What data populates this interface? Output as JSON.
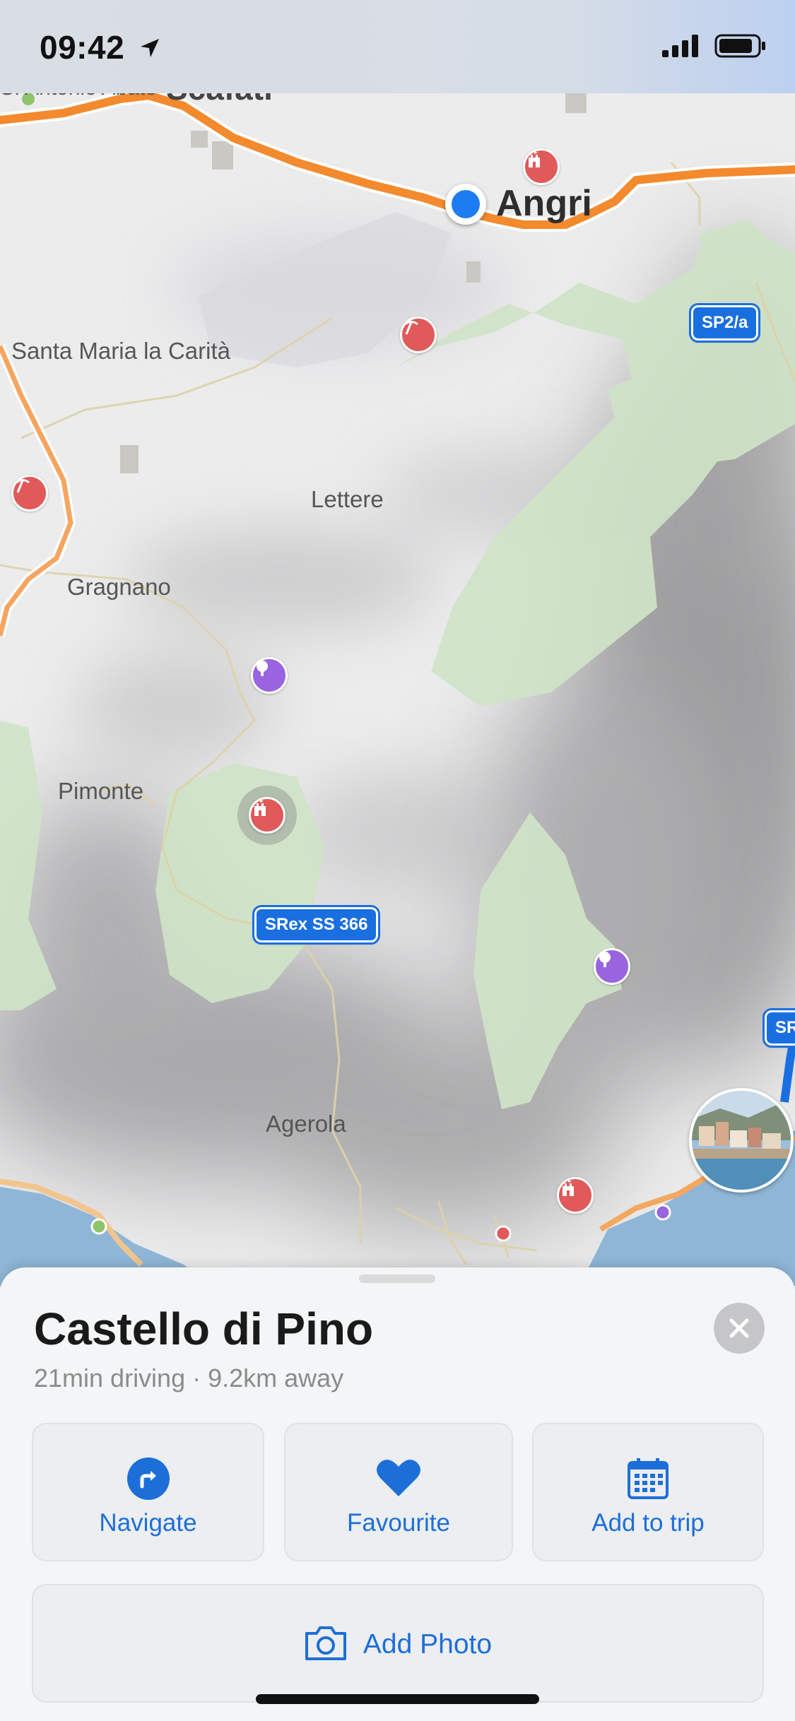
{
  "status_bar": {
    "time": "09:42"
  },
  "map": {
    "town": "Angri",
    "partial_label": "Scafati",
    "edge_label": "S. Antonio Abate",
    "places": [
      "Santa Maria la Carità",
      "Lettere",
      "Gragnano",
      "Pimonte",
      "Agerola"
    ],
    "road_shields": [
      "SP2/a",
      "SRex SS 366",
      "SR"
    ]
  },
  "sheet": {
    "title": "Castello di Pino",
    "subtitle": "21min driving · 9.2km away",
    "actions": [
      {
        "label": "Navigate",
        "icon": "navigate-icon"
      },
      {
        "label": "Favourite",
        "icon": "heart-icon"
      },
      {
        "label": "Add to trip",
        "icon": "calendar-icon"
      }
    ],
    "add_photo_label": "Add Photo"
  },
  "colors": {
    "accent": "#1d6fd8",
    "highway": "#f38a2e",
    "park": "#cfe3c7",
    "poi_red": "#e05a5a",
    "poi_purple": "#9a64e0"
  }
}
